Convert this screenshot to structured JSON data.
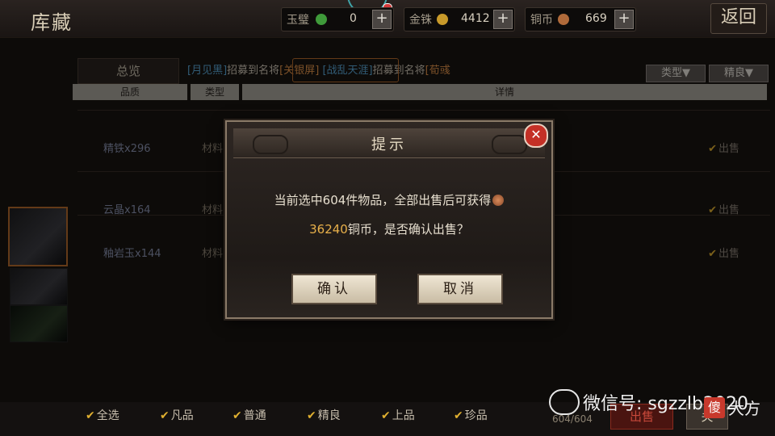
{
  "header": {
    "title": "库藏",
    "back_label": "返回",
    "resources": [
      {
        "label": "玉璧",
        "value": "0",
        "coin_color": "#3f9a3a"
      },
      {
        "label": "金铢",
        "value": "4412",
        "coin_color": "#c89a2a"
      },
      {
        "label": "铜币",
        "value": "669",
        "coin_color": "#b06a3a"
      }
    ],
    "plus_label": "+"
  },
  "tabs": {
    "overview": "总览",
    "ticker": [
      {
        "text": "[月见黑]",
        "color": "blue"
      },
      {
        "text": "招募到名将",
        "color": "plain"
      },
      {
        "text": "[关银屏]",
        "color": "orange"
      },
      {
        "text": "    ",
        "color": "plain"
      },
      {
        "text": "[战乱天涯]",
        "color": "blue"
      },
      {
        "text": "招募到名将",
        "color": "plain"
      },
      {
        "text": "[荀彧",
        "color": "orange"
      }
    ],
    "filter_type": "类型▼",
    "filter_quality": "精良▼"
  },
  "table": {
    "headers": [
      "品质",
      "类型",
      "详情"
    ],
    "rows": [
      {
        "name": "精铁x296",
        "type": "材料",
        "sell": "出售"
      },
      {
        "name": "云晶x164",
        "type": "材料",
        "sell": "出售"
      },
      {
        "name": "釉岩玉x144",
        "type": "材料",
        "sell": "出售"
      }
    ]
  },
  "footer": {
    "filters": [
      "全选",
      "凡品",
      "普通",
      "精良",
      "上品",
      "珍品"
    ],
    "count": "604/604",
    "sell_button": "出售",
    "close_button": "关"
  },
  "watermark": {
    "text": "微信号: sgzzlb2020",
    "badge": "傻",
    "logo": "大方"
  },
  "dialog": {
    "title": "提示",
    "line1": "当前选中604件物品，全部出售后可获得",
    "amount": "36240",
    "line2_rest": "铜币，是否确认出售？",
    "confirm": "确认",
    "cancel": "取消",
    "close": "✕"
  }
}
